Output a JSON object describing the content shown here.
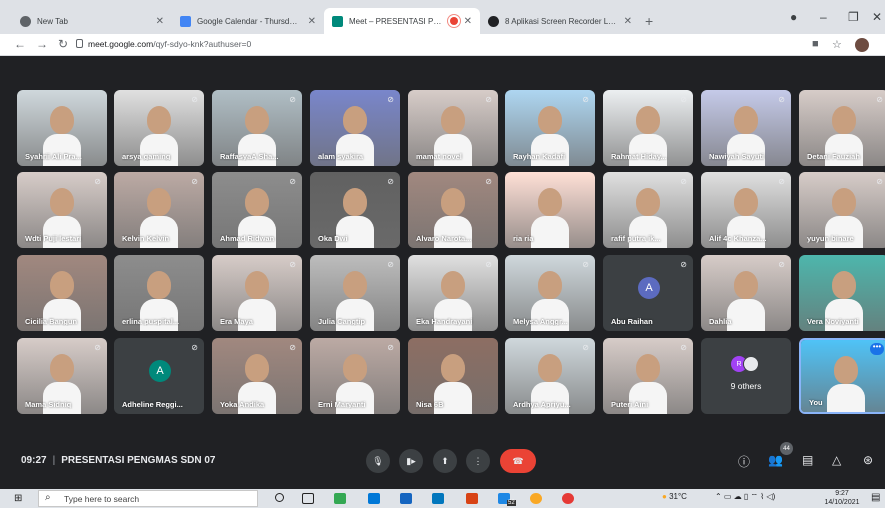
{
  "browser": {
    "tabs": [
      {
        "title": "New Tab",
        "active": false,
        "favicon_color": "#5f6368"
      },
      {
        "title": "Google Calendar - Thursday, 14 C",
        "active": false,
        "favicon_color": "#4285f4"
      },
      {
        "title": "Meet – PRESENTASI PENGM",
        "active": true,
        "favicon_color": "#00897b"
      },
      {
        "title": "8 Aplikasi Screen Recorder Laptop",
        "active": false,
        "favicon_color": "#202124"
      }
    ],
    "new_tab_symbol": "+",
    "url_host": "meet.google.com",
    "url_path": "/qyf-sdyo-knk?authuser=0"
  },
  "participants": [
    [
      {
        "name": "Syahrii Ali Pra...",
        "muted": false,
        "bg": "#cfd8dc"
      },
      {
        "name": "arsya gaming",
        "muted": true,
        "bg": "#e0e0e0"
      },
      {
        "name": "RaffasyaA Sha...",
        "muted": true,
        "bg": "#b0bec5"
      },
      {
        "name": "alam syakira",
        "muted": true,
        "bg": "#7986cb"
      },
      {
        "name": "mamat novel",
        "muted": true,
        "bg": "#d7ccc8"
      },
      {
        "name": "Rayhan Kadafi",
        "muted": true,
        "bg": "#aed6f1"
      },
      {
        "name": "Rahmat Hiday...",
        "muted": true,
        "bg": "#eceff1"
      },
      {
        "name": "Nawiyah Sayuti",
        "muted": true,
        "bg": "#c5cae9"
      },
      {
        "name": "Detani Fauziah",
        "muted": true,
        "bg": "#d7ccc8"
      }
    ],
    [
      {
        "name": "Wdti Puji lestari",
        "muted": true,
        "bg": "#d7ccc8"
      },
      {
        "name": "Kelvin Kelvin",
        "muted": true,
        "bg": "#bcaaa4"
      },
      {
        "name": "Ahmad Ridwan",
        "muted": true,
        "bg": "#8d8d8d"
      },
      {
        "name": "Oka Dwi",
        "muted": true,
        "bg": "#616161"
      },
      {
        "name": "Alvaro Narota...",
        "muted": true,
        "bg": "#a1887f"
      },
      {
        "name": "ria ria",
        "muted": false,
        "bg": "#ffe0d6"
      },
      {
        "name": "rafif putra ik...",
        "muted": true,
        "bg": "#e0e0e0"
      },
      {
        "name": "Alif 4c Khanza...",
        "muted": true,
        "bg": "#e0e0e0"
      },
      {
        "name": "yuyun binare",
        "muted": true,
        "bg": "#d7ccc8"
      }
    ],
    [
      {
        "name": "Cicilia Bangun",
        "muted": false,
        "bg": "#a1887f"
      },
      {
        "name": "erlina puspital...",
        "muted": false,
        "bg": "#8d8d8d"
      },
      {
        "name": "Era Maya",
        "muted": true,
        "bg": "#d7ccc8"
      },
      {
        "name": "Julia Cangtip",
        "muted": true,
        "bg": "#bdbdbd"
      },
      {
        "name": "Eka Handrayani",
        "muted": true,
        "bg": "#e0e0e0"
      },
      {
        "name": "Melysa Anggr...",
        "muted": true,
        "bg": "#cfd8dc"
      },
      {
        "name": "Abu Raihan",
        "muted": true,
        "avatar": "A",
        "avatar_color": "#5c6bc0"
      },
      {
        "name": "Dahlia",
        "muted": true,
        "bg": "#d7ccc8"
      },
      {
        "name": "Vera Noviyanti",
        "muted": false,
        "bg": "#4db6ac"
      }
    ],
    [
      {
        "name": "Mama Sidniq",
        "muted": true,
        "bg": "#d7ccc8"
      },
      {
        "name": "Adheline Reggi...",
        "muted": true,
        "avatar": "A",
        "avatar_color": "#00897b"
      },
      {
        "name": "Yoka Andika",
        "muted": true,
        "bg": "#a1887f"
      },
      {
        "name": "Erni Maryanti",
        "muted": true,
        "bg": "#bcaaa4"
      },
      {
        "name": "Nisa 6B",
        "muted": false,
        "bg": "#8d6e63"
      },
      {
        "name": "Ardhya Apriyu...",
        "muted": true,
        "bg": "#cfd8dc"
      },
      {
        "name": "Puteri Aini",
        "muted": true,
        "bg": "#d7ccc8"
      },
      {
        "name": "9 others",
        "muted": false,
        "others": true,
        "avatar": "R",
        "avatar_color": "#a142f4"
      },
      {
        "name": "You",
        "muted": false,
        "self": true,
        "bg": "#4fc3f7"
      }
    ]
  ],
  "meeting": {
    "time": "09:27",
    "title": "PRESENTASI PENGMAS SDN 07",
    "people_count": "44"
  },
  "icons": {
    "mic": "mic-icon",
    "camera": "camera-icon",
    "present": "present-icon",
    "more": "more-vert-icon",
    "end": "end-call-icon",
    "info": "info-icon",
    "people": "people-icon",
    "chat": "chat-icon",
    "activities": "activities-icon",
    "host": "host-controls-icon"
  },
  "taskbar": {
    "search_placeholder": "Type here to search",
    "badge": "52",
    "temperature": "31°C",
    "time": "9:27",
    "date": "14/10/2021"
  },
  "colors": {
    "meet_bg": "#202124",
    "tile_bg": "#3c4043",
    "end_call": "#ea4335",
    "accent": "#1a73e8"
  }
}
